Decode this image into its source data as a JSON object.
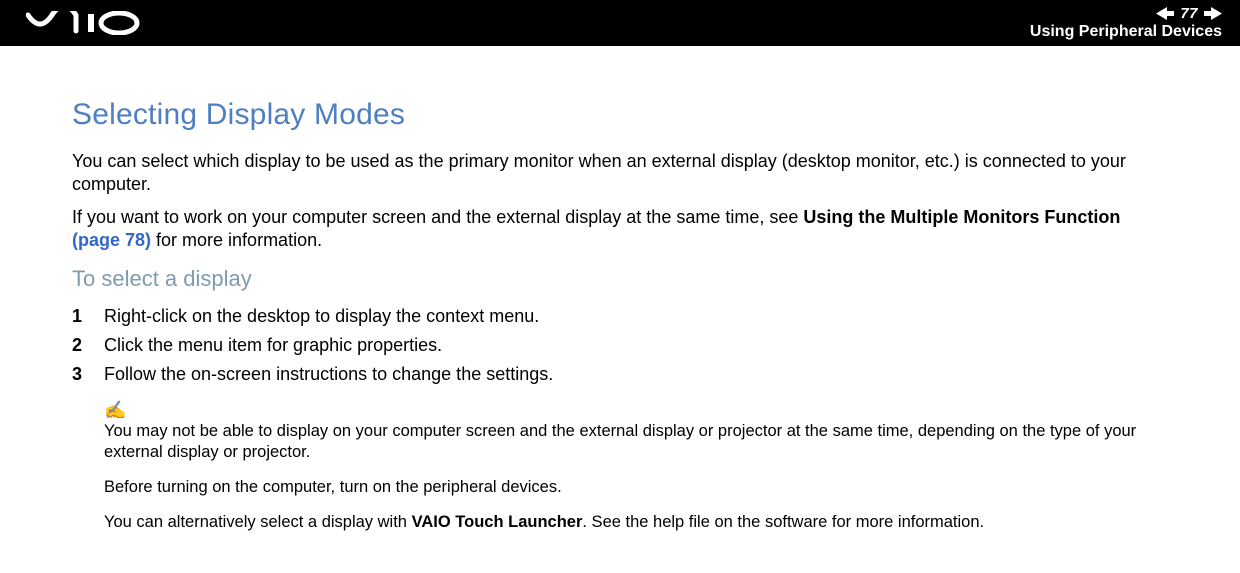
{
  "header": {
    "page_number": "77",
    "section": "Using Peripheral Devices"
  },
  "title": "Selecting Display Modes",
  "intro1": "You can select which display to be used as the primary monitor when an external display (desktop monitor, etc.) is connected to your computer.",
  "intro2_a": "If you want to work on your computer screen and the external display at the same time, see ",
  "intro2_bold": "Using the Multiple Monitors Function",
  "intro2_link": " (page 78)",
  "intro2_b": " for more information.",
  "subhead": "To select a display",
  "steps": [
    {
      "n": "1",
      "t": "Right-click on the desktop to display the context menu."
    },
    {
      "n": "2",
      "t": "Click the menu item for graphic properties."
    },
    {
      "n": "3",
      "t": "Follow the on-screen instructions to change the settings."
    }
  ],
  "note_icon": "✍",
  "note1": "You may not be able to display on your computer screen and the external display or projector at the same time, depending on the type of your external display or projector.",
  "note2": "Before turning on the computer, turn on the peripheral devices.",
  "note3_a": "You can alternatively select a display with ",
  "note3_bold": "VAIO Touch Launcher",
  "note3_b": ". See the help file on the software for more information."
}
